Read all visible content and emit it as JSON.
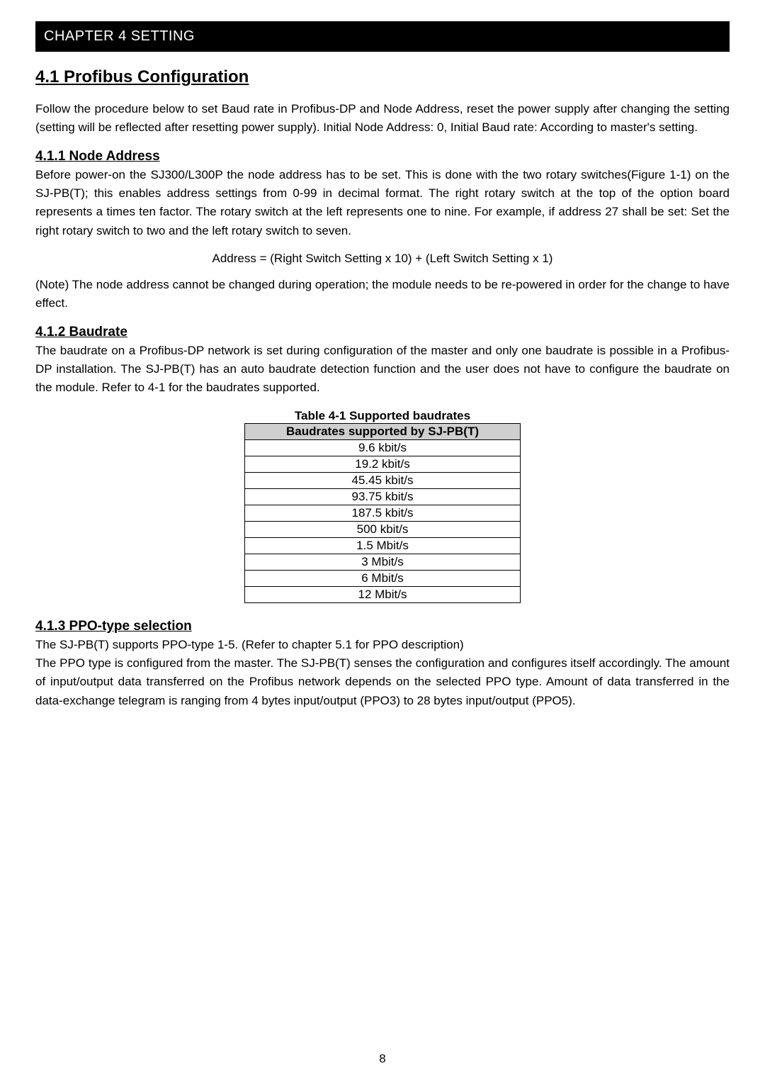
{
  "chapter_bar": "CHAPTER 4    SETTING",
  "section_4_1": {
    "heading": "4.1 Profibus Configuration",
    "intro": "Follow the procedure below to set Baud rate in Profibus-DP and Node Address, reset the power supply after changing the setting (setting will be reflected after resetting power supply). Initial Node Address: 0, Initial Baud rate: According to master's setting."
  },
  "section_4_1_1": {
    "heading": "4.1.1 Node Address",
    "para1": "Before power-on the SJ300/L300P the node address has to be set. This is done with the two rotary switches(Figure 1-1) on the SJ-PB(T); this enables address settings from 0-99 in decimal format. The right rotary switch at the top of the option board represents a times ten factor. The rotary switch at the left represents one to nine. For example, if address 27 shall be set: Set the right rotary switch to two and the left rotary switch to seven.",
    "formula": "Address = (Right Switch Setting x 10) + (Left Switch Setting x 1)",
    "note": "(Note) The node address cannot be changed during operation; the module needs to be re-powered in order for the change to have effect."
  },
  "section_4_1_2": {
    "heading": "4.1.2 Baudrate",
    "para1": "The baudrate on a Profibus-DP network is set during configuration of the master and only one baudrate is possible in a Profibus-DP installation. The SJ-PB(T) has an auto baudrate detection function and the user does not have to configure the baudrate on the module. Refer to 4-1 for the baudrates supported."
  },
  "table_4_1": {
    "caption": "Table 4-1 Supported baudrates",
    "header": "Baudrates supported by SJ-PB(T)",
    "rows": [
      "9.6 kbit/s",
      "19.2 kbit/s",
      "45.45 kbit/s",
      "93.75 kbit/s",
      "187.5 kbit/s",
      "500 kbit/s",
      "1.5 Mbit/s",
      "3 Mbit/s",
      "6 Mbit/s",
      "12 Mbit/s"
    ]
  },
  "section_4_1_3": {
    "heading": "4.1.3 PPO-type selection",
    "para1": "The SJ-PB(T) supports PPO-type 1-5. (Refer to chapter 5.1 for PPO description)",
    "para2": "The PPO type is configured from the master. The SJ-PB(T) senses the configuration and configures itself accordingly. The amount of input/output data transferred on the Profibus network depends on the selected PPO type. Amount of data transferred in the data-exchange telegram is ranging from 4 bytes input/output (PPO3) to 28 bytes input/output (PPO5)."
  },
  "page_number": "8"
}
